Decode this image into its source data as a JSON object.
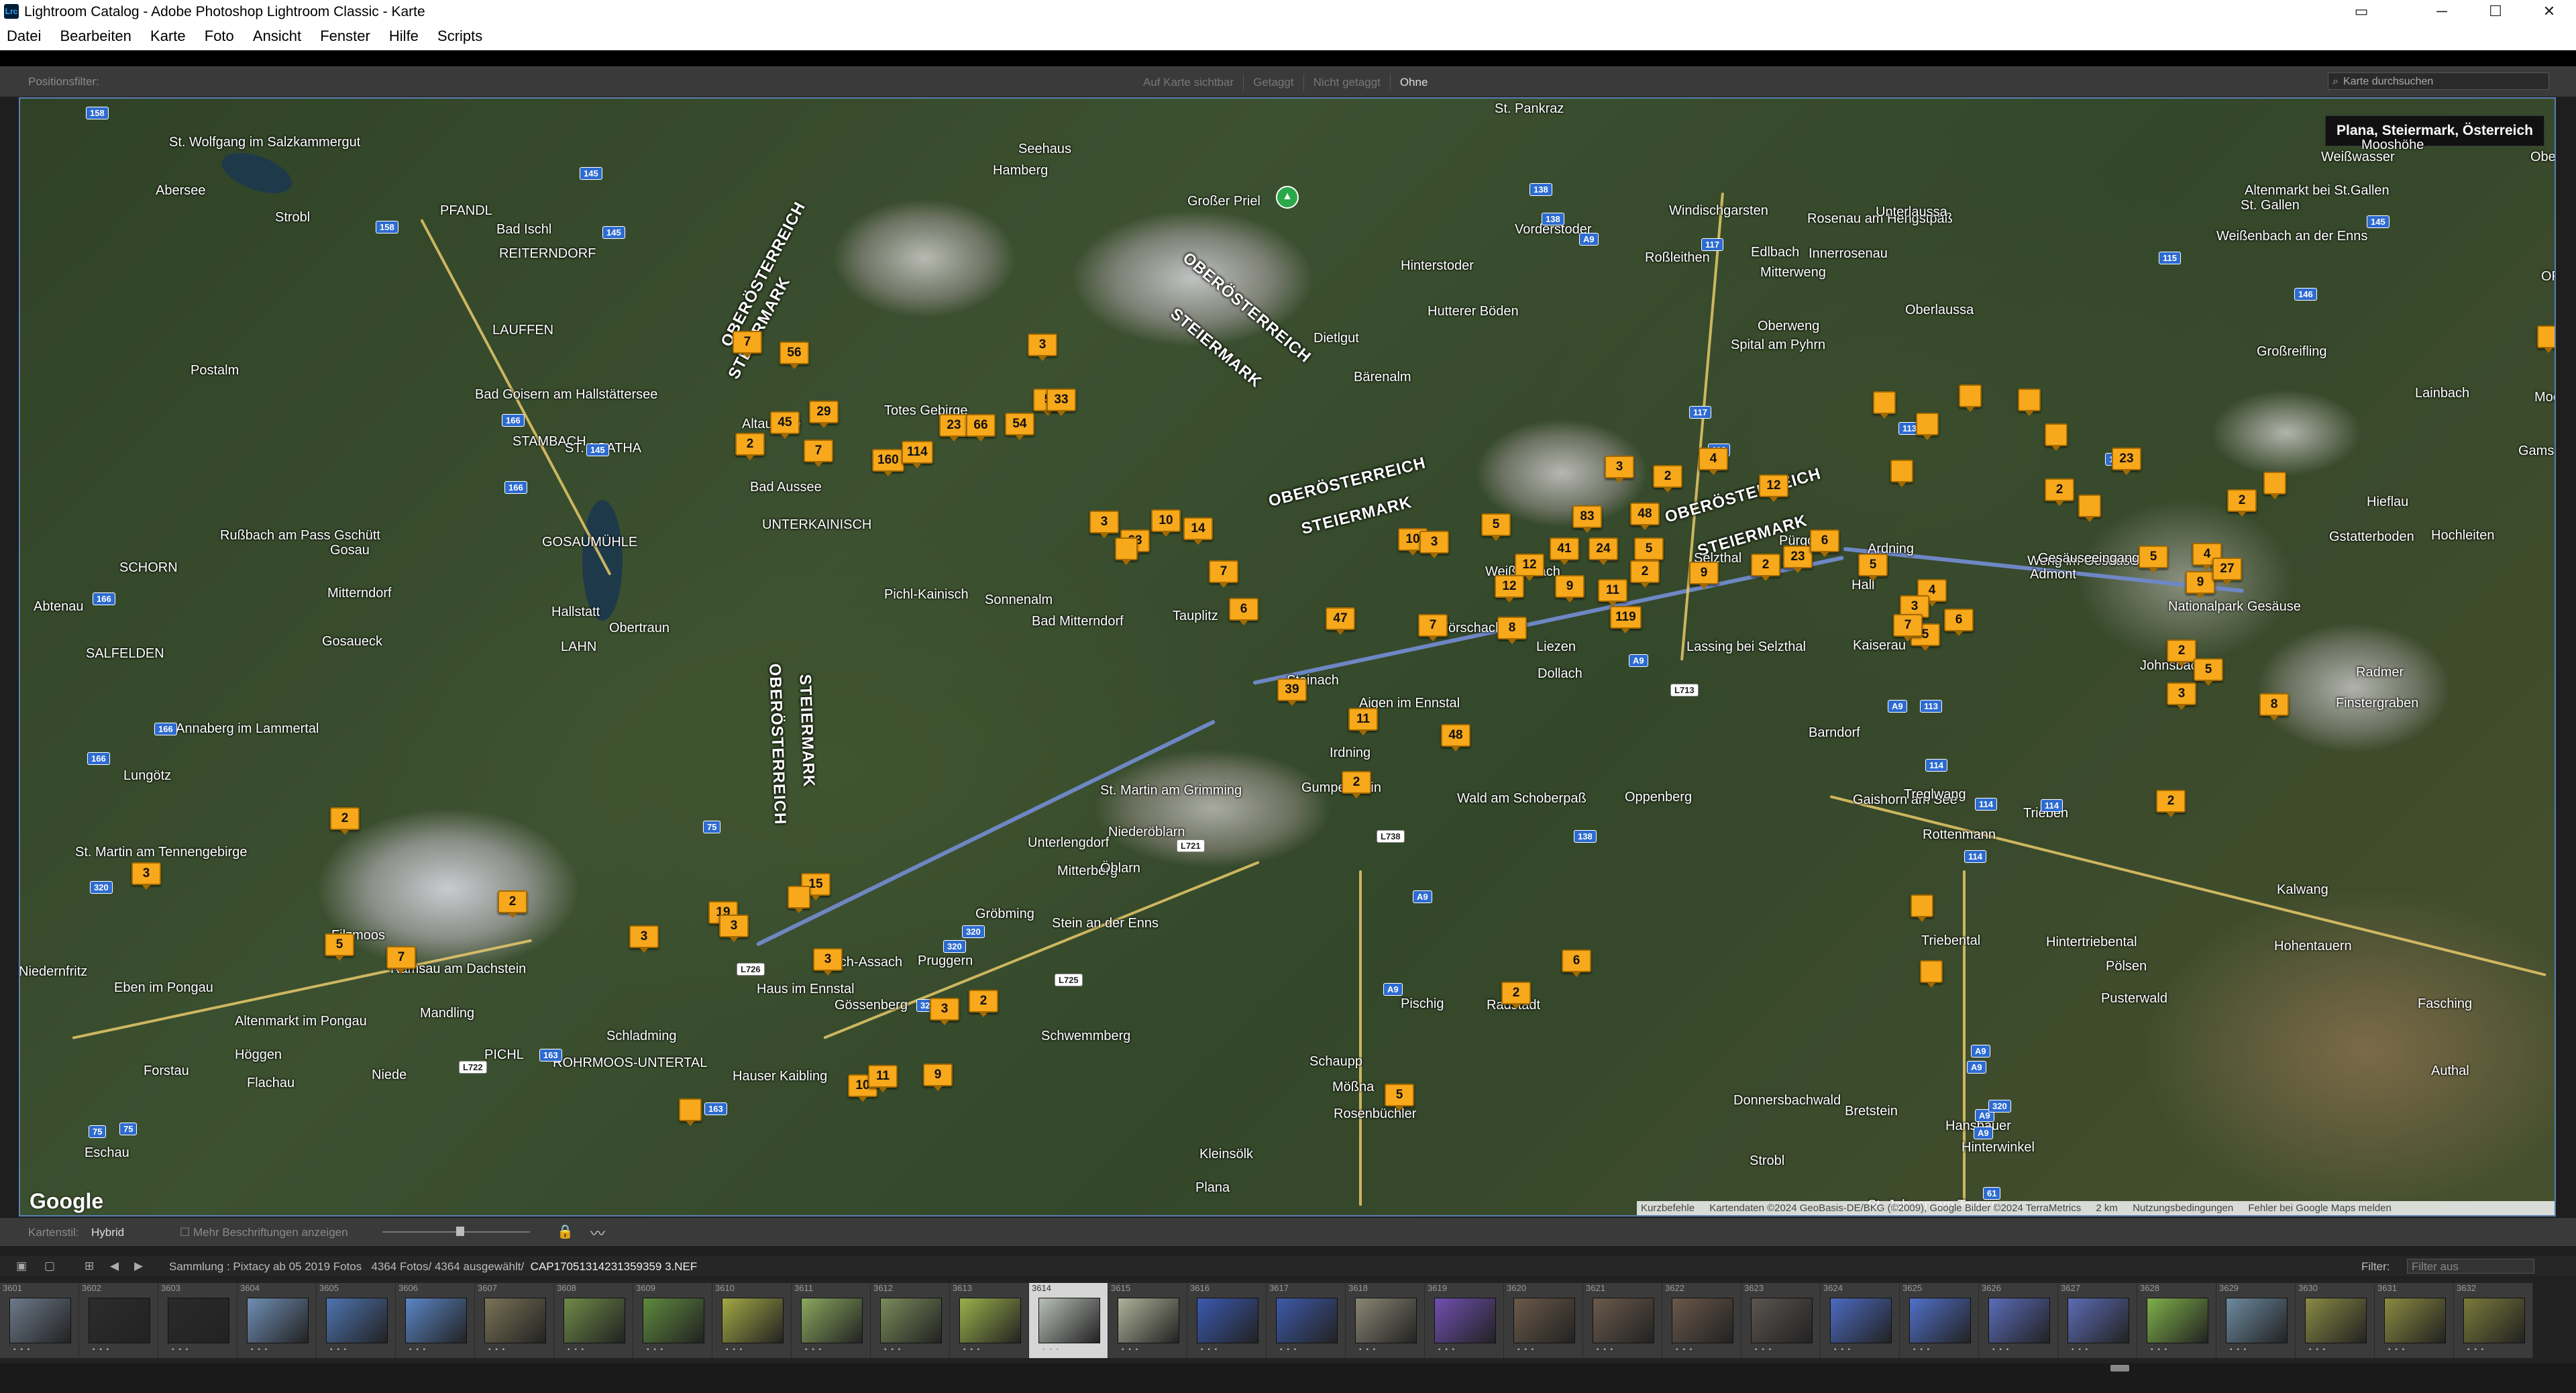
{
  "window": {
    "title": "Lightroom Catalog - Adobe Photoshop Lightroom Classic - Karte",
    "app_icon": "Lrc",
    "controls": [
      "▭",
      "─",
      "☐",
      "✕"
    ]
  },
  "menu": [
    "Datei",
    "Bearbeiten",
    "Karte",
    "Foto",
    "Ansicht",
    "Fenster",
    "Hilfe",
    "Scripts"
  ],
  "location_filter": {
    "label": "Positionsfilter:",
    "options": [
      "Auf Karte sichtbar",
      "Getaggt",
      "Nicht getaggt",
      "Ohne"
    ],
    "active": "Ohne",
    "search_placeholder": "Karte durchsuchen"
  },
  "map": {
    "tooltip": "Plana, Steiermark, Österreich",
    "logo": "Google",
    "attribution": [
      "Kurzbefehle",
      "Kartendaten ©2024 GeoBasis-DE/BKG (©2009), Google Bilder ©2024 TerraMetrics",
      "2 km",
      "Nutzungsbedingungen",
      "Fehler bei Google Maps melden"
    ],
    "peak_label": "Großer Priel",
    "regions": [
      "OBERÖSTERREICH",
      "STEIERMARK",
      "OBERÖSTERREICH",
      "STEIERMARK",
      "OBERÖSTERREICH",
      "STEIERMARK",
      "OBERÖSTERREICH",
      "STEIERMARK",
      "OBERÖSTERREICH",
      "STEIERMARK"
    ],
    "places": [
      "St. Wolfgang im Salzkammergut",
      "Abersee",
      "Strobl",
      "PFANDL",
      "Bad Ischl",
      "REITERNDORF",
      "LAUFFEN",
      "Postalm",
      "Bad Goisern am Hallstättersee",
      "STAMBACH",
      "ST. AGATHA",
      "GOSAUMÜHLE",
      "Rußbach am Pass Gschütt",
      "Gosau",
      "SCHORN",
      "Abtenau",
      "Mitterndorf",
      "Hinterstoder",
      "Vorderstoder",
      "Windischgarsten",
      "Roßleithen",
      "Edlbach",
      "Rosenau am Hengstpaß",
      "Innerrosenau",
      "Unterlaussa",
      "Altenmarkt bei St.Gallen",
      "St. Gallen",
      "Weißenbach an der Enns",
      "Oberlaussa",
      "Spital am Pyhrn",
      "Mitterweng",
      "Oberweng",
      "Dietlgut",
      "Bärenalm",
      "Hutterer Böden",
      "Hamberg",
      "Seehaus",
      "Totes Gebirge",
      "Altaussee",
      "Bad Aussee",
      "UNTERKAINISCH",
      "Pichl-Kainisch",
      "Sonnenalm",
      "Bad Mitterndorf",
      "Tauplitz",
      "Obertraun",
      "LAHN",
      "Hallstatt",
      "Gosaueck",
      "Annaberg im Lammertal",
      "Lungötz",
      "SALFELDEN",
      "St. Martin am Tennengebirge",
      "Niedernfritz",
      "Eben im Pongau",
      "Filzmoos",
      "Ramsau am Dachstein",
      "Mandling",
      "PICHL",
      "ROHRMOOS-UNTERTAL",
      "Schladming",
      "Haus im Ennstal",
      "Aich-Assach",
      "Gössenberg",
      "Hauser Kaibling",
      "Pruggern",
      "Gröbming",
      "Stein an der Enns",
      "Mitterberg",
      "Öblarn",
      "Niederöblarn",
      "Unterlengdorf",
      "St. Martin am Grimming",
      "Stainach",
      "Aigen im Ennstal",
      "Irdning",
      "Gumpenstein",
      "Wörschach",
      "Weißenbach",
      "Liezen",
      "Dollach",
      "Lassing bei Selzthal",
      "Selzthal",
      "Pürgg",
      "Ardning",
      "Hall",
      "Admont",
      "Weng im Gesäuse",
      "Gesäuseeingang",
      "Gstatterboden",
      "Hochleiten",
      "Hieflau",
      "Gams bei Hieflau",
      "Moosland",
      "Lainbach",
      "Großreifling",
      "Mooshöhe",
      "Weißwasser",
      "St. Pankraz",
      "Nationalpark Gesäuse",
      "Kaiserau",
      "Johnsbach",
      "Radmer",
      "Finstergraben",
      "Barndorf",
      "Gaishorn am See",
      "Treglwang",
      "Trieben",
      "Rottenmann",
      "Oppenberg",
      "Wald am Schoberpaß",
      "Kalwang",
      "Hohentauern",
      "Triebental",
      "Hintertriebental",
      "Pölsen",
      "Pusterwald",
      "Pischig",
      "Fasching",
      "Authal",
      "Bretstein",
      "St. Johann am Tauern",
      "Hansbauer",
      "Hinterwinkel",
      "Donnersbachwald",
      "Strobl",
      "Schaupp",
      "Mößna",
      "Rosenbüchler",
      "Kleinsölk",
      "Plana",
      "Schwemmberg",
      "Radstadt",
      "Altenmarkt im Pongau",
      "Höggen",
      "Forstau",
      "Flachau",
      "Niede",
      "Eschau",
      "Oberreith",
      "OFFENSEE"
    ],
    "shields": [
      "158",
      "145",
      "158",
      "145",
      "145",
      "166",
      "166",
      "166",
      "166",
      "166",
      "320",
      "320",
      "320",
      "320",
      "L725",
      "L726",
      "L721",
      "L722",
      "163",
      "163",
      "75",
      "75",
      "75",
      "L738",
      "A9",
      "A9",
      "138",
      "138",
      "138",
      "A9",
      "117",
      "117",
      "115",
      "115",
      "145",
      "146",
      "113",
      "113",
      "A9",
      "L713",
      "A9",
      "113",
      "114",
      "114",
      "114",
      "114",
      "A9",
      "A9",
      "A9",
      "A9",
      "320",
      "61"
    ],
    "clusters": [
      "7",
      "56",
      "29",
      "45",
      "2",
      "7",
      "160",
      "114",
      "23",
      "66",
      "54",
      "3",
      "5",
      "33",
      "3",
      "63",
      "10",
      "14",
      "7",
      "6",
      "47",
      "39",
      "11",
      "48",
      "2",
      "10",
      "3",
      "5",
      "83",
      "48",
      "12",
      "41",
      "24",
      "5",
      "12",
      "9",
      "11",
      "2",
      "119",
      "7",
      "8",
      "3",
      "2",
      "4",
      "12",
      "2",
      "9",
      "23",
      "6",
      "5",
      "4",
      "3",
      "5",
      "7",
      "6",
      "2",
      "23",
      "5",
      "4",
      "9",
      "27",
      "2",
      "2",
      "5",
      "8",
      "3",
      "2",
      "6",
      "2",
      "5",
      "3",
      "2",
      "9",
      "10",
      "11",
      "3",
      "15",
      "19",
      "3",
      "3",
      "2",
      "5",
      "7",
      "3",
      "2"
    ],
    "single_pins": 14
  },
  "toolbar": {
    "style_label": "Kartenstil:",
    "style_value": "Hybrid",
    "more_labels": "Mehr Beschriftungen anzeigen"
  },
  "filmstrip_info": {
    "collection": "Sammlung : Pixtacy ab 05 2019 Fotos",
    "counts": "4364 Fotos/ 4364 ausgewählt/",
    "filename": "CAP17051314231359359 3.NEF",
    "filter_label": "Filter:",
    "filter_value": "Filter aus"
  },
  "filmstrip": {
    "numbers": [
      "3601",
      "3602",
      "3603",
      "3604",
      "3605",
      "3606",
      "3607",
      "3608",
      "3609",
      "3610",
      "3611",
      "3612",
      "3613",
      "3614",
      "3615",
      "3616",
      "3617",
      "3618",
      "3619",
      "3620",
      "3621",
      "3622",
      "3623",
      "3624",
      "3625",
      "3626",
      "3627",
      "3628",
      "3629",
      "3630",
      "3631",
      "3632"
    ],
    "selected_index": 13
  }
}
